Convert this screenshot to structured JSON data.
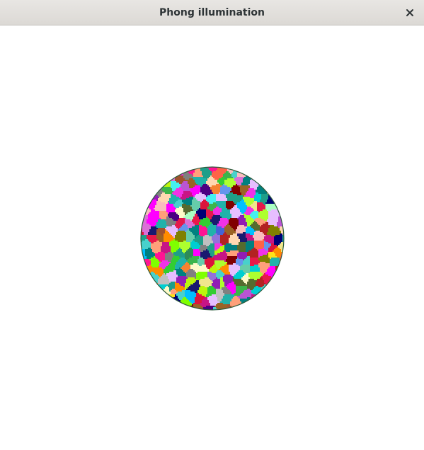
{
  "window": {
    "title": "Phong illumination",
    "close_icon": "close-icon"
  },
  "scene": {
    "object": "tessellated-sphere",
    "background_color": "#ffffff",
    "outline_color": "#2b5a3a",
    "palette": [
      "#e6194b",
      "#3cb44b",
      "#ffe119",
      "#4363d8",
      "#f58231",
      "#911eb4",
      "#46f0f0",
      "#f032e6",
      "#bcf60c",
      "#fabebe",
      "#008080",
      "#e6beff",
      "#9a6324",
      "#fffac8",
      "#800000",
      "#aaffc3",
      "#808000",
      "#ffd8b1",
      "#000075",
      "#808080",
      "#1f9e89",
      "#c71585",
      "#7fff00",
      "#00bfff",
      "#ff6347",
      "#9370db",
      "#20b2aa",
      "#ff1493",
      "#556b2f",
      "#ba55d3",
      "#00ced1",
      "#ff8c00",
      "#2e8b57",
      "#dc143c",
      "#6495ed",
      "#adff2f",
      "#da70d6",
      "#b22222",
      "#48d1cc",
      "#c0c0c0",
      "#191970",
      "#ff00ff",
      "#32cd32",
      "#a0522d",
      "#f0e68c",
      "#4b0082",
      "#66cdaa",
      "#ffa07a"
    ]
  }
}
